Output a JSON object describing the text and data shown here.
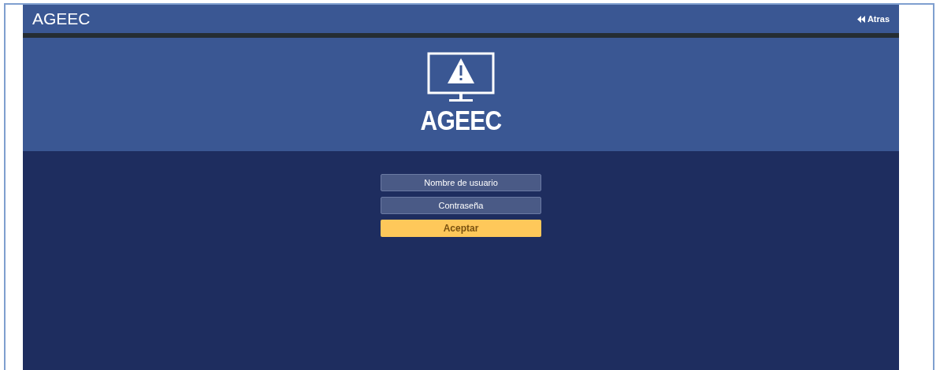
{
  "header": {
    "title": "AGEEC",
    "back_link": "Atras"
  },
  "banner": {
    "logo_text": "AGEEC"
  },
  "login": {
    "username": {
      "placeholder": "Nombre de usuario"
    },
    "password": {
      "placeholder": "Contraseña"
    },
    "submit": "Aceptar"
  }
}
